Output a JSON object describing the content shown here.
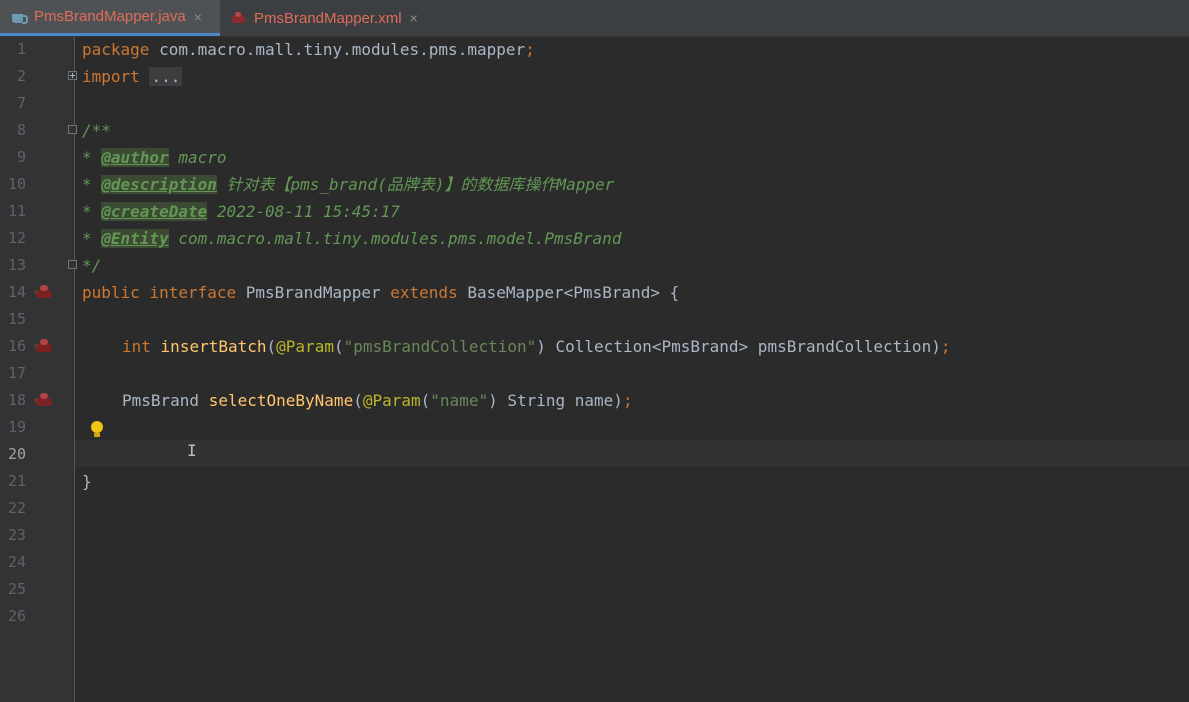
{
  "tabs": [
    {
      "label": "PmsBrandMapper.java",
      "close": "×",
      "icon": "java-file-icon",
      "active": true
    },
    {
      "label": "PmsBrandMapper.xml",
      "close": "×",
      "icon": "mybatis-xml-icon",
      "active": false
    }
  ],
  "gutter": {
    "line_numbers": [
      "1",
      "2",
      "7",
      "8",
      "9",
      "10",
      "11",
      "12",
      "13",
      "14",
      "15",
      "16",
      "17",
      "18",
      "19",
      "20",
      "21",
      "22",
      "23",
      "24",
      "25",
      "26"
    ],
    "current_line": "20"
  },
  "code": {
    "l1_kw": "package",
    "l1_rest": " com.macro.mall.tiny.modules.pms.mapper",
    "l1_semi": ";",
    "l2_kw": "import",
    "l2_fold": "...",
    "l8": "/**",
    "l9_star": "* ",
    "l9_tag": "@author",
    "l9_text": " macro",
    "l10_star": "* ",
    "l10_tag": "@description",
    "l10_text": " 针对表【pms_brand(品牌表)】的数据库操作Mapper",
    "l11_star": "* ",
    "l11_tag": "@createDate",
    "l11_text": " 2022-08-11 15:45:17",
    "l12_star": "* ",
    "l12_tag": "@Entity",
    "l12_text": " com.macro.mall.tiny.modules.pms.model.PmsBrand",
    "l13": "*/",
    "l14_kw1": "public",
    "l14_kw2": "interface",
    "l14_name": " PmsBrandMapper ",
    "l14_kw3": "extends",
    "l14_rest": " BaseMapper<PmsBrand> {",
    "l16_kw": "int",
    "l16_fn": "insertBatch",
    "l16_p1": "(",
    "l16_ann": "@Param",
    "l16_p2": "(",
    "l16_str": "\"pmsBrandCollection\"",
    "l16_rest": ") Collection<PmsBrand> pmsBrandCollection)",
    "l16_semi": ";",
    "l18_type": "PmsBrand ",
    "l18_fn": "selectOneByName",
    "l18_p1": "(",
    "l18_ann": "@Param",
    "l18_p2": "(",
    "l18_str": "\"name\"",
    "l18_rest": ") String name)",
    "l18_semi": ";",
    "l21": "}"
  },
  "colors": {
    "keyword": "#cc7832",
    "comment": "#629755",
    "annotation": "#bbb529",
    "string": "#6a8759",
    "method": "#ffc66d",
    "text": "#a9b7c6",
    "background": "#2b2b2b"
  }
}
